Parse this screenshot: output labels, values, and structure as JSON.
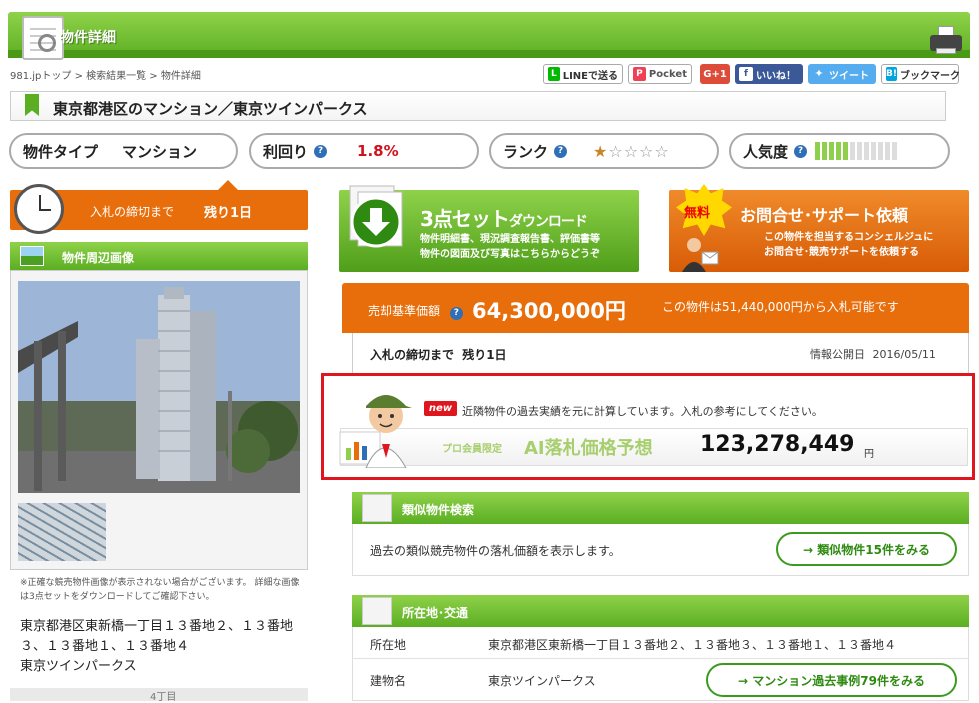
{
  "header": {
    "title": "物件詳細"
  },
  "breadcrumb": "981.jpトップ > 検索結果一覧 > 物件詳細",
  "share": {
    "line": "LINEで送る",
    "pocket": "Pocket",
    "gplus": "G+1",
    "facebook": "いいね！",
    "twitter": "ツイート",
    "hatena_icon": "B!",
    "hatena": "ブックマーク"
  },
  "property_title": "東京都港区のマンション／東京ツインパークス",
  "stats": {
    "type_label": "物件タイプ",
    "type_value": "マンション",
    "yield_label": "利回り",
    "yield_value": "1.8%",
    "rank_label": "ランク",
    "rank_stars_filled": 1,
    "rank_stars_total": 5,
    "popularity_label": "人気度",
    "popularity_filled": 5,
    "popularity_total": 12,
    "help_icon": "?"
  },
  "deadline": {
    "label": "入札の締切まで",
    "value": "残り1日"
  },
  "photo_section": {
    "title": "物件周辺画像",
    "note": "※正確な競売物件画像が表示されない場合がございます。 詳細な画像は3点セットをダウンロードしてご確認下さい。",
    "address": "東京都港区東新橋一丁目１３番地２、１３番地３、１３番地１、１３番地４",
    "building": "東京ツインパークス",
    "map_label": "4丁目"
  },
  "download_banner": {
    "title_main": "3点セット",
    "title_sub": "ダウンロード",
    "desc_line1": "物件明細書、現況調査報告書、評価書等",
    "desc_line2": "物件の図面及び写真はこちらからどうぞ"
  },
  "contact_banner": {
    "badge": "無料",
    "title": "お問合せ･サポート依頼",
    "desc_line1": "この物件を担当するコンシェルジュに",
    "desc_line2": "お問合せ･競売サポートを依頼する"
  },
  "price": {
    "label": "売却基準価額",
    "value": "64,300,000円",
    "note": "この物件は51,440,000円から入札可能です"
  },
  "info": {
    "deadline_label": "入札の締切まで",
    "deadline_value": "残り1日",
    "published_label": "情報公開日",
    "published_date": "2016/05/11"
  },
  "ai_prediction": {
    "new_badge": "new",
    "description": "近隣物件の過去実績を元に計算しています。入札の参考にしてください。",
    "pro_label": "プロ会員限定",
    "label": "AI落札価格予想",
    "value": "123,278,449",
    "unit": "円"
  },
  "similar": {
    "title": "類似物件検索",
    "description": "過去の類似競売物件の落札価額を表示します。",
    "button": "→ 類似物件15件をみる"
  },
  "location": {
    "title": "所在地･交通",
    "address_label": "所在地",
    "address_value": "東京都港区東新橋一丁目１３番地２、１３番地３、１３番地１、１３番地４",
    "building_label": "建物名",
    "building_value": "東京ツインパークス",
    "button": "→ マンション過去事例79件をみる"
  },
  "colors": {
    "green": "#5bae22",
    "orange": "#e86e0c",
    "red_highlight": "#e0161e",
    "yield_red": "#d0121b"
  }
}
